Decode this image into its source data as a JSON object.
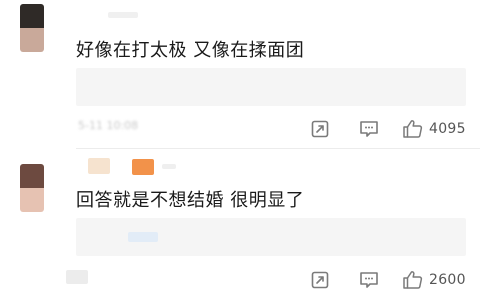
{
  "colors": {
    "text": "#1a1a1a",
    "muted": "#555555",
    "reply_bg": "#f5f5f5",
    "icon": "#7a7a7a"
  },
  "icons": {
    "share": "share-icon",
    "comment": "comment-icon",
    "like": "thumbs-up-icon"
  },
  "comments": [
    {
      "text": "好像在打太极 又像在揉面团",
      "time": "5-11 10:08",
      "likes": "4095"
    },
    {
      "text": "回答就是不想结婚 很明显了",
      "likes": "2600"
    }
  ]
}
